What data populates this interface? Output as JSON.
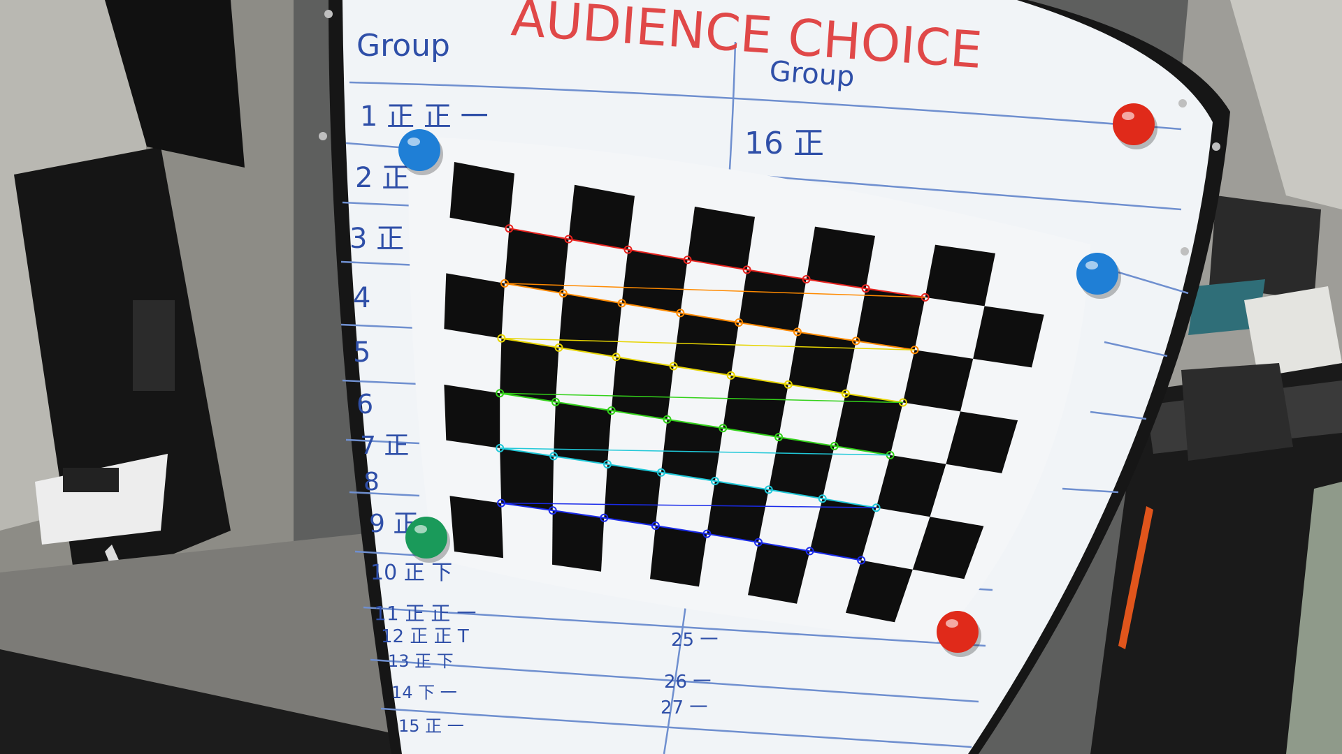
{
  "whiteboard": {
    "heading": "AUDIENCE CHOICE",
    "left_column_header": "Group",
    "right_column_header": "Group",
    "left_rows": [
      {
        "label": "1 正 正 一"
      },
      {
        "label": "2 正"
      },
      {
        "label": "3 正"
      },
      {
        "label": "4"
      },
      {
        "label": "5"
      },
      {
        "label": "6"
      },
      {
        "label": "7 正"
      },
      {
        "label": "8"
      },
      {
        "label": "9 正"
      },
      {
        "label": "10 正 下"
      },
      {
        "label": "11 正 正 一"
      },
      {
        "label": "12 正 正 T"
      },
      {
        "label": "13 正 下"
      },
      {
        "label": "14 下 一"
      },
      {
        "label": "15 正 一"
      }
    ],
    "right_rows": [
      {
        "label": "16 正"
      },
      {
        "label": "25 一"
      },
      {
        "label": "26 一"
      },
      {
        "label": "27 一"
      }
    ]
  },
  "checkerboard": {
    "grid_columns": 9,
    "grid_rows": 6,
    "corner_row_colors": [
      "#e8231f",
      "#ff8a00",
      "#e6d400",
      "#33d11a",
      "#1fc8d8",
      "#1a2bea"
    ]
  },
  "magnets": [
    {
      "name": "blue-magnet-top-left",
      "color": "#1f7fd6"
    },
    {
      "name": "red-magnet-top-right",
      "color": "#e02a1a"
    },
    {
      "name": "blue-magnet-right",
      "color": "#1f7fd6"
    },
    {
      "name": "green-magnet-bottom-left",
      "color": "#1a9a5a"
    },
    {
      "name": "red-magnet-bottom-right",
      "color": "#e02a1a"
    }
  ]
}
